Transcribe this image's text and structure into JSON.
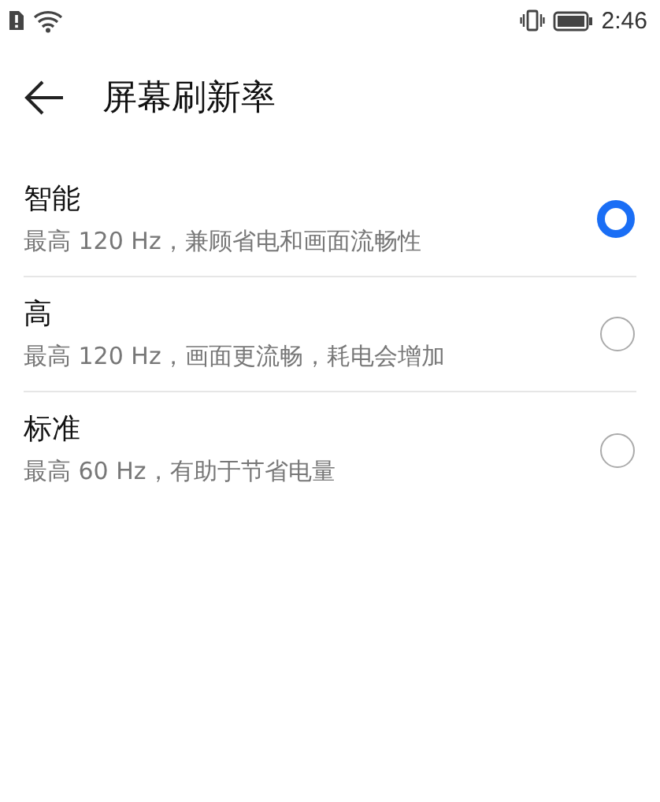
{
  "status_bar": {
    "time": "2:46"
  },
  "header": {
    "title": "屏幕刷新率"
  },
  "options": [
    {
      "title": "智能",
      "description": "最高 120 Hz，兼顾省电和画面流畅性",
      "selected": true
    },
    {
      "title": "高",
      "description": "最高 120 Hz，画面更流畅，耗电会增加",
      "selected": false
    },
    {
      "title": "标准",
      "description": "最高 60 Hz，有助于节省电量",
      "selected": false
    }
  ]
}
